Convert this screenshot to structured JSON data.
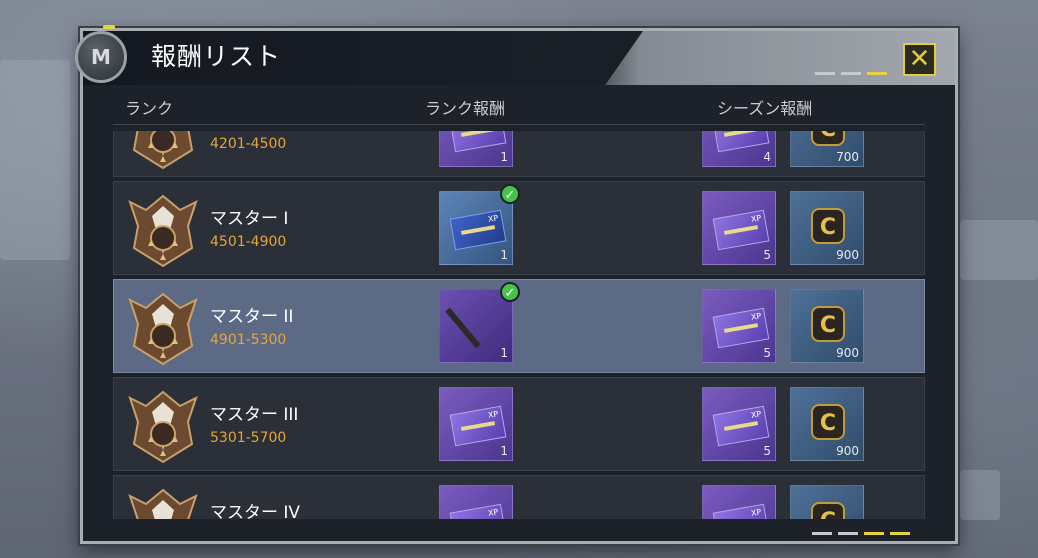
{
  "dialog": {
    "title": "報酬リスト",
    "logo_glyph": "M"
  },
  "columns": {
    "rank": "ランク",
    "rank_reward": "ランク報酬",
    "season_reward": "シーズン報酬"
  },
  "rows": [
    {
      "name": "",
      "range": "4201-4500",
      "rank_reward": {
        "type": "xp-card",
        "count": "1",
        "claimed": false
      },
      "season_rewards": [
        {
          "type": "xp-card",
          "count": "4"
        },
        {
          "type": "cp-coin",
          "count": "700"
        }
      ],
      "selected": false
    },
    {
      "name": "マスター I",
      "range": "4501-4900",
      "rank_reward": {
        "type": "weapon-xp-card",
        "count": "1",
        "claimed": true
      },
      "season_rewards": [
        {
          "type": "xp-card",
          "count": "5"
        },
        {
          "type": "cp-coin",
          "count": "900"
        }
      ],
      "selected": false
    },
    {
      "name": "マスター II",
      "range": "4901-5300",
      "rank_reward": {
        "type": "rifle-blueprint",
        "count": "1",
        "claimed": true
      },
      "season_rewards": [
        {
          "type": "xp-card",
          "count": "5"
        },
        {
          "type": "cp-coin",
          "count": "900"
        }
      ],
      "selected": true
    },
    {
      "name": "マスター III",
      "range": "5301-5700",
      "rank_reward": {
        "type": "xp-card",
        "count": "1",
        "claimed": false
      },
      "season_rewards": [
        {
          "type": "xp-card",
          "count": "5"
        },
        {
          "type": "cp-coin",
          "count": "900"
        }
      ],
      "selected": false
    },
    {
      "name": "マスター IV",
      "range": "",
      "rank_reward": {
        "type": "xp-card",
        "count": "",
        "claimed": false
      },
      "season_rewards": [
        {
          "type": "xp-card",
          "count": ""
        },
        {
          "type": "cp-coin",
          "count": ""
        }
      ],
      "selected": false
    }
  ],
  "icons": {
    "close": "close-icon",
    "check": "check-icon",
    "coin_glyph": "C",
    "check_glyph": "✓",
    "close_glyph": "✕"
  },
  "colors": {
    "accent": "#e3cd3b",
    "range_text": "#e5a53a",
    "selected_row": "#5d6a86",
    "claimed": "#49c24b"
  }
}
